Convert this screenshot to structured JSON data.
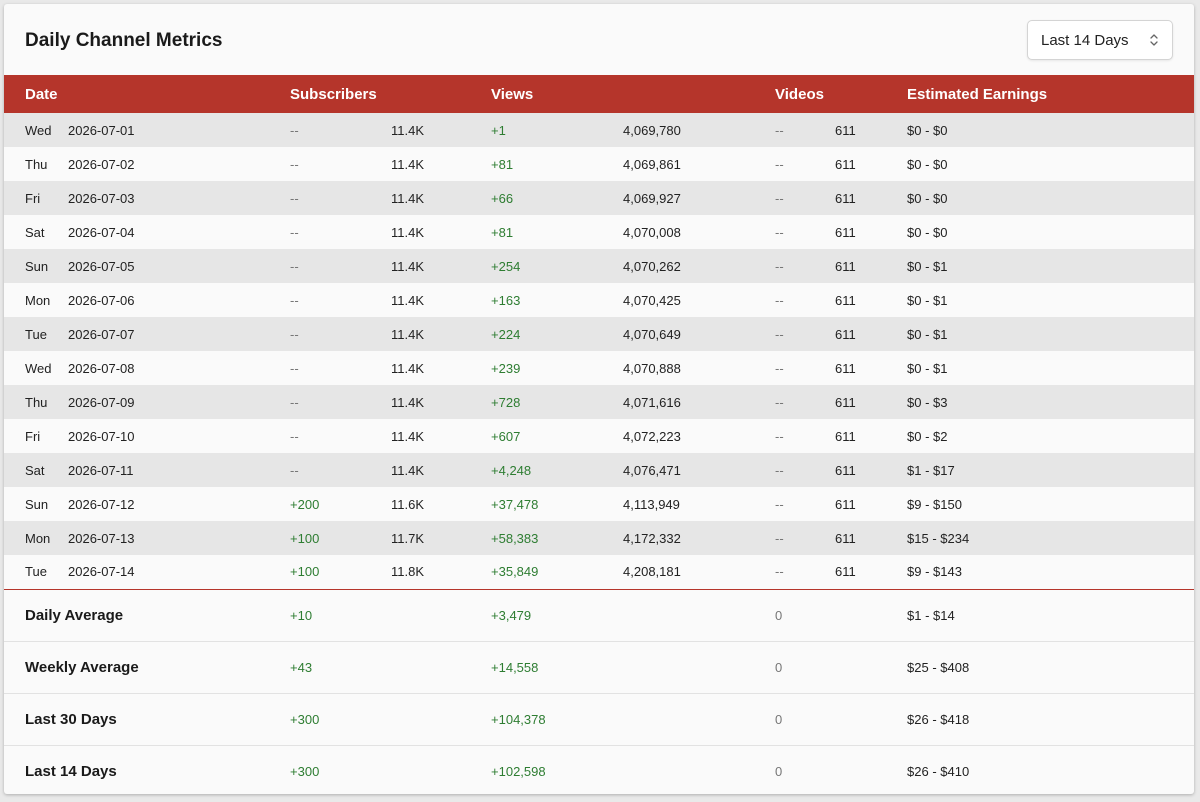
{
  "title": "Daily Channel Metrics",
  "range_select": {
    "value": "Last 14 Days"
  },
  "columns": {
    "date": "Date",
    "subscribers": "Subscribers",
    "views": "Views",
    "videos": "Videos",
    "earnings": "Estimated Earnings"
  },
  "rows": [
    {
      "day": "Wed",
      "date": "2026-07-01",
      "sub_delta": "--",
      "sub_total": "11.4K",
      "views_delta": "+1",
      "views_total": "4,069,780",
      "videos_delta": "--",
      "videos_total": "611",
      "earnings": "$0 - $0"
    },
    {
      "day": "Thu",
      "date": "2026-07-02",
      "sub_delta": "--",
      "sub_total": "11.4K",
      "views_delta": "+81",
      "views_total": "4,069,861",
      "videos_delta": "--",
      "videos_total": "611",
      "earnings": "$0 - $0"
    },
    {
      "day": "Fri",
      "date": "2026-07-03",
      "sub_delta": "--",
      "sub_total": "11.4K",
      "views_delta": "+66",
      "views_total": "4,069,927",
      "videos_delta": "--",
      "videos_total": "611",
      "earnings": "$0 - $0"
    },
    {
      "day": "Sat",
      "date": "2026-07-04",
      "sub_delta": "--",
      "sub_total": "11.4K",
      "views_delta": "+81",
      "views_total": "4,070,008",
      "videos_delta": "--",
      "videos_total": "611",
      "earnings": "$0 - $0"
    },
    {
      "day": "Sun",
      "date": "2026-07-05",
      "sub_delta": "--",
      "sub_total": "11.4K",
      "views_delta": "+254",
      "views_total": "4,070,262",
      "videos_delta": "--",
      "videos_total": "611",
      "earnings": "$0 - $1"
    },
    {
      "day": "Mon",
      "date": "2026-07-06",
      "sub_delta": "--",
      "sub_total": "11.4K",
      "views_delta": "+163",
      "views_total": "4,070,425",
      "videos_delta": "--",
      "videos_total": "611",
      "earnings": "$0 - $1"
    },
    {
      "day": "Tue",
      "date": "2026-07-07",
      "sub_delta": "--",
      "sub_total": "11.4K",
      "views_delta": "+224",
      "views_total": "4,070,649",
      "videos_delta": "--",
      "videos_total": "611",
      "earnings": "$0 - $1"
    },
    {
      "day": "Wed",
      "date": "2026-07-08",
      "sub_delta": "--",
      "sub_total": "11.4K",
      "views_delta": "+239",
      "views_total": "4,070,888",
      "videos_delta": "--",
      "videos_total": "611",
      "earnings": "$0 - $1"
    },
    {
      "day": "Thu",
      "date": "2026-07-09",
      "sub_delta": "--",
      "sub_total": "11.4K",
      "views_delta": "+728",
      "views_total": "4,071,616",
      "videos_delta": "--",
      "videos_total": "611",
      "earnings": "$0 - $3"
    },
    {
      "day": "Fri",
      "date": "2026-07-10",
      "sub_delta": "--",
      "sub_total": "11.4K",
      "views_delta": "+607",
      "views_total": "4,072,223",
      "videos_delta": "--",
      "videos_total": "611",
      "earnings": "$0 - $2"
    },
    {
      "day": "Sat",
      "date": "2026-07-11",
      "sub_delta": "--",
      "sub_total": "11.4K",
      "views_delta": "+4,248",
      "views_total": "4,076,471",
      "videos_delta": "--",
      "videos_total": "611",
      "earnings": "$1 - $17"
    },
    {
      "day": "Sun",
      "date": "2026-07-12",
      "sub_delta": "+200",
      "sub_total": "11.6K",
      "views_delta": "+37,478",
      "views_total": "4,113,949",
      "videos_delta": "--",
      "videos_total": "611",
      "earnings": "$9 - $150"
    },
    {
      "day": "Mon",
      "date": "2026-07-13",
      "sub_delta": "+100",
      "sub_total": "11.7K",
      "views_delta": "+58,383",
      "views_total": "4,172,332",
      "videos_delta": "--",
      "videos_total": "611",
      "earnings": "$15 - $234"
    },
    {
      "day": "Tue",
      "date": "2026-07-14",
      "sub_delta": "+100",
      "sub_total": "11.8K",
      "views_delta": "+35,849",
      "views_total": "4,208,181",
      "videos_delta": "--",
      "videos_total": "611",
      "earnings": "$9 - $143"
    }
  ],
  "summary": [
    {
      "label": "Daily Average",
      "subscribers": "+10",
      "views": "+3,479",
      "videos": "0",
      "earnings": "$1 - $14"
    },
    {
      "label": "Weekly Average",
      "subscribers": "+43",
      "views": "+14,558",
      "videos": "0",
      "earnings": "$25 - $408"
    },
    {
      "label": "Last 30 Days",
      "subscribers": "+300",
      "views": "+104,378",
      "videos": "0",
      "earnings": "$26 - $418"
    },
    {
      "label": "Last 14 Days",
      "subscribers": "+300",
      "views": "+102,598",
      "videos": "0",
      "earnings": "$26 - $410"
    }
  ],
  "colors": {
    "header_bg": "#b5352b",
    "positive": "#2e7d32",
    "muted": "#777777"
  },
  "icons": {
    "range_select": "chevron-up-down-icon"
  }
}
